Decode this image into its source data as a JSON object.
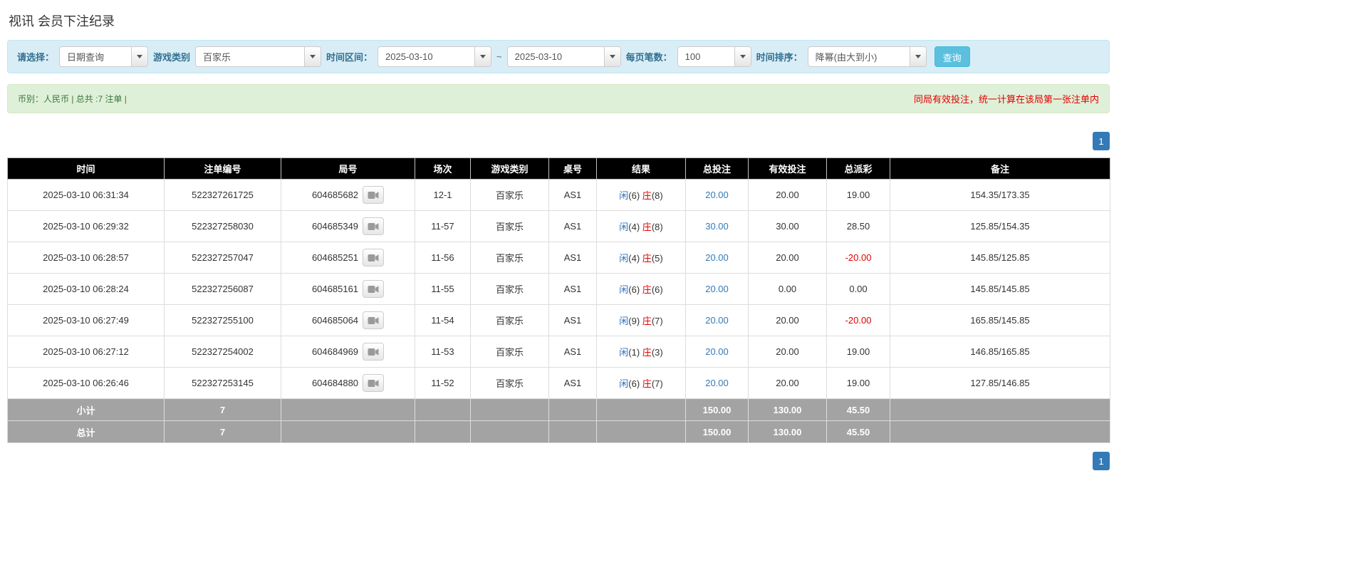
{
  "page": {
    "title": "视讯 会员下注纪录"
  },
  "colors": {
    "filter_bar_bg": "#d9edf7",
    "info_bar_bg": "#dff0d8",
    "header_bg": "#000000",
    "sum_row_bg": "#a3a3a3",
    "link_blue": "#337ab7",
    "player_blue": "#2f6fc1",
    "banker_red": "#e10000",
    "negative_red": "#e10000",
    "search_button_bg": "#5bc0de",
    "pagination_active_bg": "#337ab7"
  },
  "icons": {
    "dropdown_caret": "caret-down",
    "round_button": "video-replay"
  },
  "filter_bar": {
    "select_label": "请选择：",
    "select_value": "日期查询",
    "game_type_label": "游戏类别",
    "game_type_value": "百家乐",
    "time_range_label": "时间区间：",
    "date_from": "2025-03-10",
    "tilde": "~",
    "date_to": "2025-03-10",
    "page_size_label": "每页笔数：",
    "page_size_value": "100",
    "sort_label": "时间排序：",
    "sort_value": "降幂(由大到小)",
    "search_button": "查询"
  },
  "info_bar": {
    "left_text": "币别：人民币 | 总共 :7 注单 |",
    "right_text": "同局有效投注，统一计算在该局第一张注单内"
  },
  "pagination": {
    "page": "1"
  },
  "table": {
    "headers": [
      "时间",
      "注单编号",
      "局号",
      "场次",
      "游戏类别",
      "桌号",
      "结果",
      "总投注",
      "有效投注",
      "总派彩",
      "备注"
    ],
    "rows": [
      {
        "time": "2025-03-10 06:31:34",
        "bet_id": "522327261725",
        "round_id": "604685682",
        "session": "12-1",
        "game": "百家乐",
        "table_no": "AS1",
        "result_player": "闲(6)",
        "result_banker": "庄(8)",
        "total_bet": "20.00",
        "valid_bet": "20.00",
        "payout": "19.00",
        "note": "154.35/173.35"
      },
      {
        "time": "2025-03-10 06:29:32",
        "bet_id": "522327258030",
        "round_id": "604685349",
        "session": "11-57",
        "game": "百家乐",
        "table_no": "AS1",
        "result_player": "闲(4)",
        "result_banker": "庄(8)",
        "total_bet": "30.00",
        "valid_bet": "30.00",
        "payout": "28.50",
        "note": "125.85/154.35"
      },
      {
        "time": "2025-03-10 06:28:57",
        "bet_id": "522327257047",
        "round_id": "604685251",
        "session": "11-56",
        "game": "百家乐",
        "table_no": "AS1",
        "result_player": "闲(4)",
        "result_banker": "庄(5)",
        "total_bet": "20.00",
        "valid_bet": "20.00",
        "payout": "-20.00",
        "note": "145.85/125.85"
      },
      {
        "time": "2025-03-10 06:28:24",
        "bet_id": "522327256087",
        "round_id": "604685161",
        "session": "11-55",
        "game": "百家乐",
        "table_no": "AS1",
        "result_player": "闲(6)",
        "result_banker": "庄(6)",
        "total_bet": "20.00",
        "valid_bet": "0.00",
        "payout": "0.00",
        "note": "145.85/145.85"
      },
      {
        "time": "2025-03-10 06:27:49",
        "bet_id": "522327255100",
        "round_id": "604685064",
        "session": "11-54",
        "game": "百家乐",
        "table_no": "AS1",
        "result_player": "闲(9)",
        "result_banker": "庄(7)",
        "total_bet": "20.00",
        "valid_bet": "20.00",
        "payout": "-20.00",
        "note": "165.85/145.85"
      },
      {
        "time": "2025-03-10 06:27:12",
        "bet_id": "522327254002",
        "round_id": "604684969",
        "session": "11-53",
        "game": "百家乐",
        "table_no": "AS1",
        "result_player": "闲(1)",
        "result_banker": "庄(3)",
        "total_bet": "20.00",
        "valid_bet": "20.00",
        "payout": "19.00",
        "note": "146.85/165.85"
      },
      {
        "time": "2025-03-10 06:26:46",
        "bet_id": "522327253145",
        "round_id": "604684880",
        "session": "11-52",
        "game": "百家乐",
        "table_no": "AS1",
        "result_player": "闲(6)",
        "result_banker": "庄(7)",
        "total_bet": "20.00",
        "valid_bet": "20.00",
        "payout": "19.00",
        "note": "127.85/146.85"
      }
    ],
    "subtotal": {
      "label": "小计",
      "count": "7",
      "total_bet": "150.00",
      "valid_bet": "130.00",
      "payout": "45.50"
    },
    "total": {
      "label": "总计",
      "count": "7",
      "total_bet": "150.00",
      "valid_bet": "130.00",
      "payout": "45.50"
    }
  }
}
